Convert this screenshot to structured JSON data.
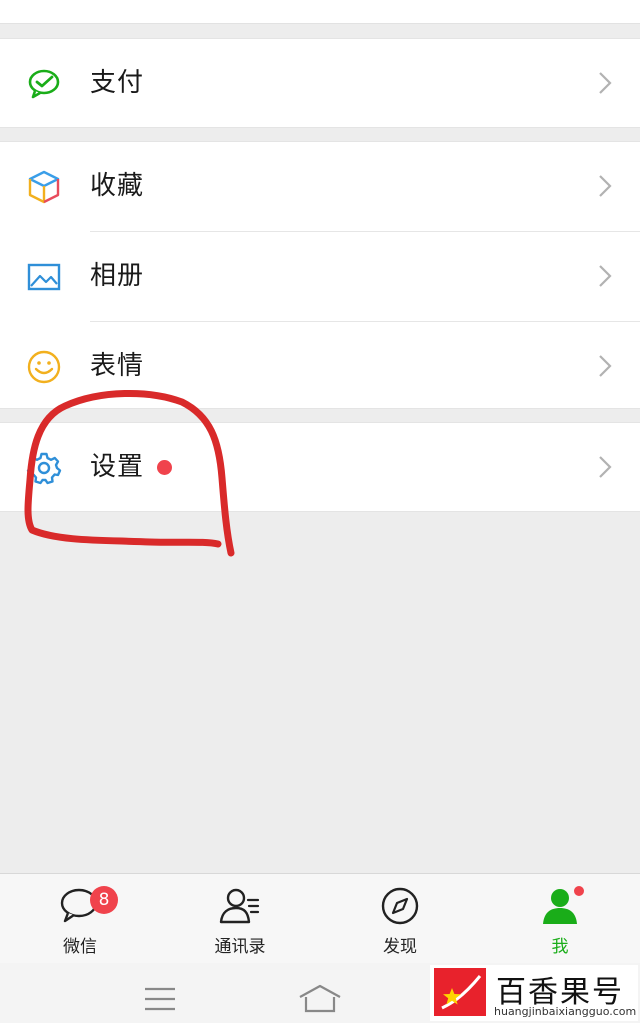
{
  "menu": {
    "pay": {
      "label": "支付",
      "icon": "wechat-pay-icon"
    },
    "favorites": {
      "label": "收藏",
      "icon": "cube-icon"
    },
    "album": {
      "label": "相册",
      "icon": "picture-icon"
    },
    "stickers": {
      "label": "表情",
      "icon": "smiley-icon"
    },
    "settings": {
      "label": "设置",
      "icon": "gear-icon",
      "has_new_dot": true
    }
  },
  "tabbar": {
    "tabs": [
      {
        "label": "微信",
        "icon": "chat-bubble-icon",
        "badge": "8"
      },
      {
        "label": "通讯录",
        "icon": "contacts-icon"
      },
      {
        "label": "发现",
        "icon": "compass-icon"
      },
      {
        "label": "我",
        "icon": "person-icon",
        "active": true,
        "has_new_dot": true
      }
    ]
  },
  "watermark": {
    "title": "百香果号",
    "url": "huangjinbaixiangguo.com"
  },
  "colors": {
    "accent_green": "#1aad19",
    "badge_red": "#f0434c",
    "annotation_red": "#d92a2a",
    "background": "#ededed"
  }
}
